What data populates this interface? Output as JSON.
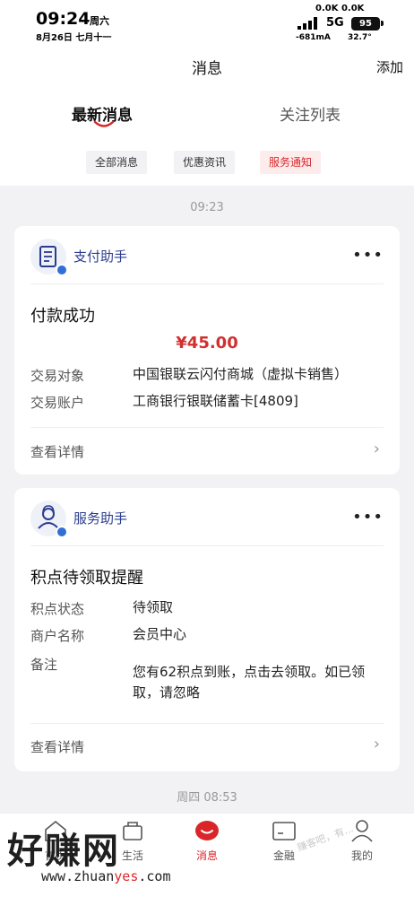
{
  "status_bar": {
    "time": "09:24",
    "weekday": "周六",
    "date": "8月26日 七月十一",
    "net_speed": "0.0K 0.0K",
    "network": "5G",
    "battery": "95",
    "current": "-681mA",
    "temperature": "32.7°"
  },
  "header": {
    "title": "消息",
    "add_label": "添加",
    "tabs": [
      {
        "label": "最新消息",
        "active": true
      },
      {
        "label": "关注列表",
        "active": false
      }
    ],
    "chips": [
      {
        "label": "全部消息",
        "active": false
      },
      {
        "label": "优惠资讯",
        "active": false
      },
      {
        "label": "服务通知",
        "active": true
      }
    ]
  },
  "messages": [
    {
      "timestamp": "09:23",
      "service": "支付助手",
      "icon": "document-icon",
      "title": "付款成功",
      "amount": "¥45.00",
      "rows": [
        {
          "label": "交易对象",
          "value": "中国银联云闪付商城（虚拟卡销售）"
        },
        {
          "label": "交易账户",
          "value": "工商银行银联储蓄卡[4809]"
        }
      ],
      "detail_label": "查看详情"
    },
    {
      "service": "服务助手",
      "icon": "service-person-icon",
      "title": "积点待领取提醒",
      "rows": [
        {
          "label": "积点状态",
          "value": "待领取"
        },
        {
          "label": "商户名称",
          "value": "会员中心"
        },
        {
          "label": "备注",
          "value": "您有62积点到账，点击去领取。如已领取，请忽略"
        }
      ],
      "detail_label": "查看详情"
    }
  ],
  "next_timestamp": "周四 08:53",
  "bottom_nav": [
    {
      "label": "首页",
      "icon": "home-icon"
    },
    {
      "label": "生活",
      "icon": "life-icon"
    },
    {
      "label": "消息",
      "icon": "message-icon",
      "active": true
    },
    {
      "label": "金融",
      "icon": "finance-icon"
    },
    {
      "label": "我的",
      "icon": "profile-icon"
    }
  ],
  "watermark": {
    "text": "好赚网",
    "url_prefix": "www.zhuan",
    "url_accent": "yes",
    "url_suffix": ".com",
    "diagonal": "赚客吧，有..."
  },
  "colors": {
    "accent": "#d9262b",
    "service_blue": "#2a3c8f",
    "verified_blue": "#2f6fd6",
    "background": "#f2f2f4"
  }
}
